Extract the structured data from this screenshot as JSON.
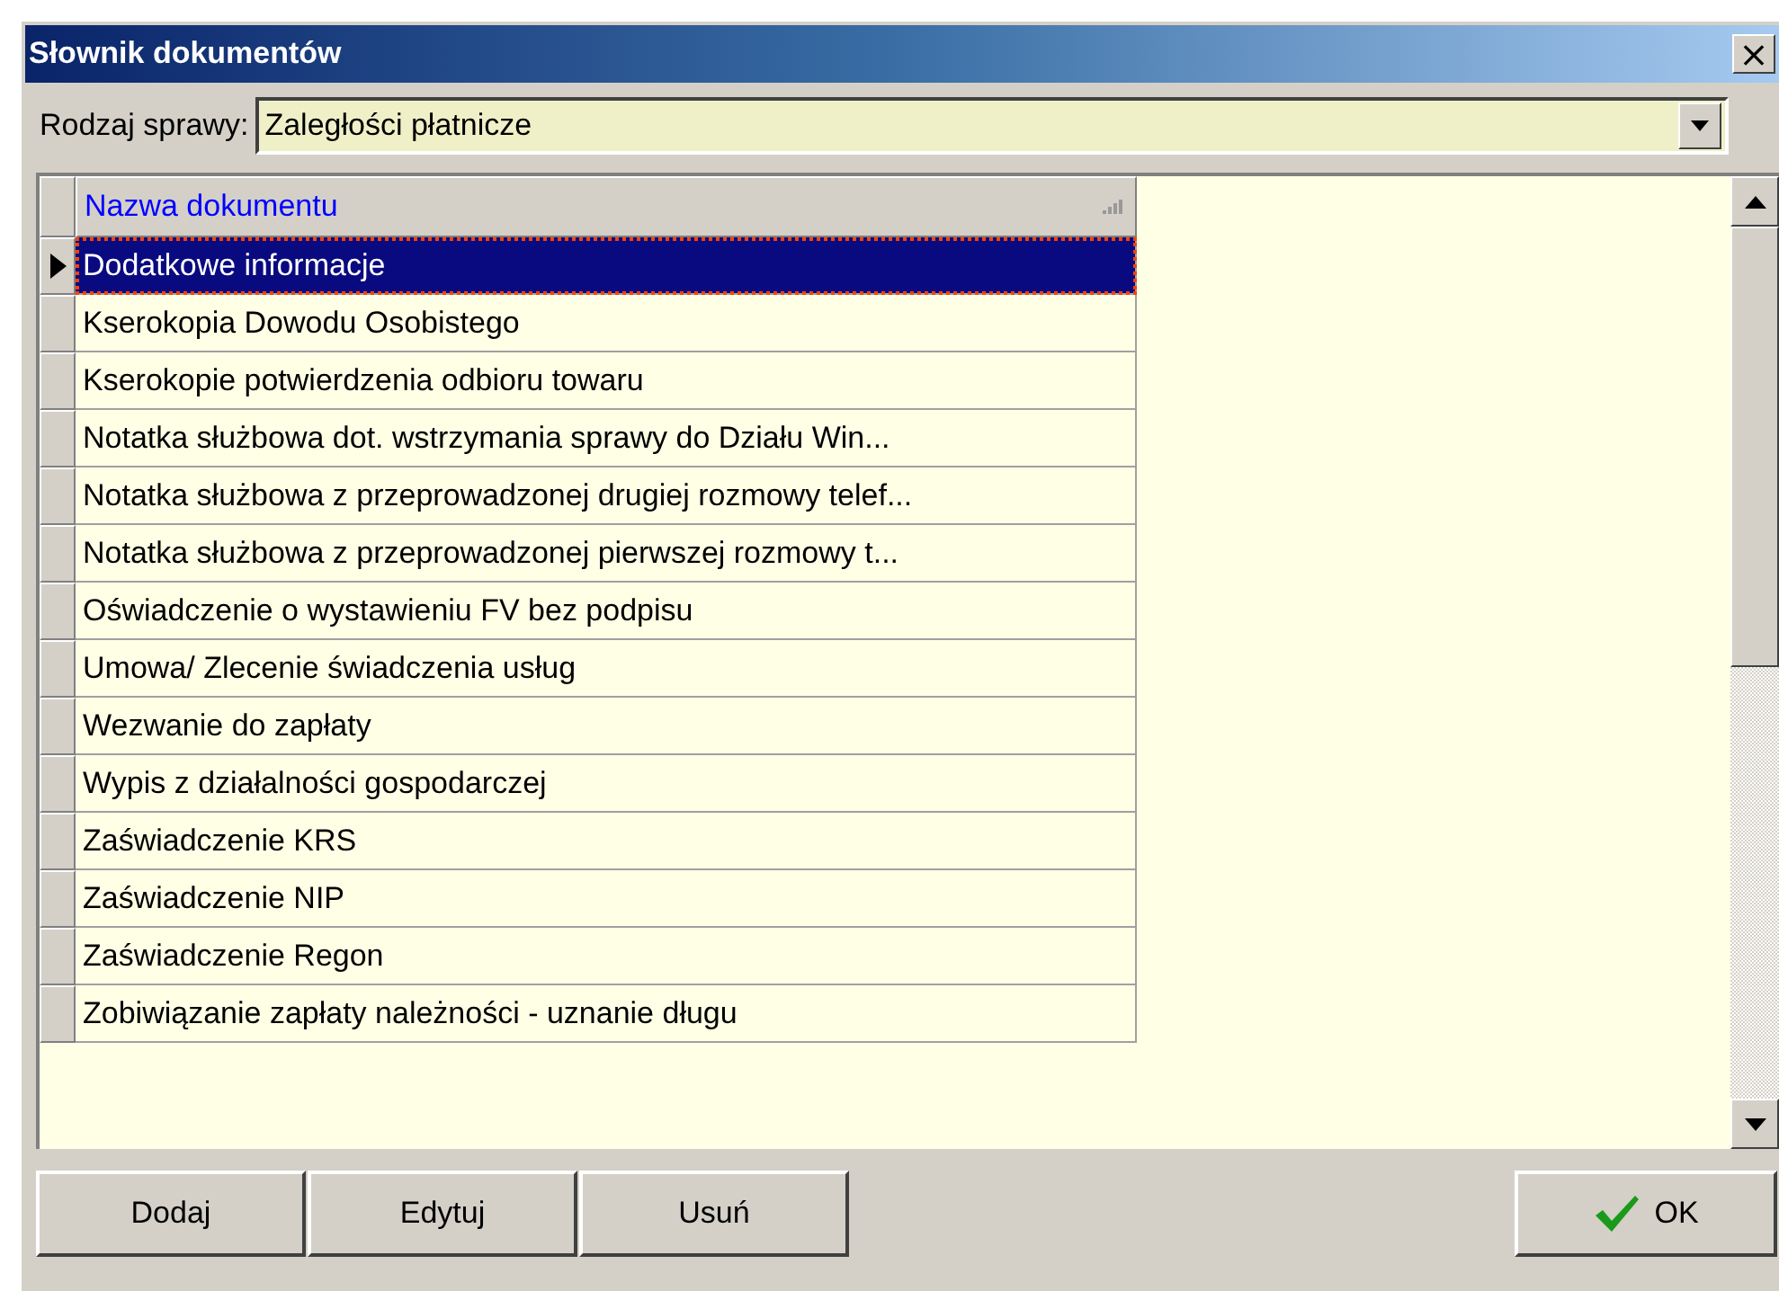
{
  "window": {
    "title": "Słownik dokumentów",
    "close": "×"
  },
  "filter": {
    "label": "Rodzaj sprawy:",
    "value": "Zaległości płatnicze"
  },
  "table": {
    "columns": [
      "Nazwa dokumentu"
    ],
    "rows": [
      {
        "name": "Dodatkowe informacje",
        "selected": true
      },
      {
        "name": "Kserokopia Dowodu Osobistego",
        "selected": false
      },
      {
        "name": "Kserokopie potwierdzenia odbioru towaru",
        "selected": false
      },
      {
        "name": "Notatka służbowa dot. wstrzymania sprawy do Działu Win...",
        "selected": false
      },
      {
        "name": "Notatka służbowa z przeprowadzonej drugiej rozmowy telef...",
        "selected": false
      },
      {
        "name": "Notatka służbowa z przeprowadzonej pierwszej rozmowy t...",
        "selected": false
      },
      {
        "name": "Oświadczenie o wystawieniu FV bez podpisu",
        "selected": false
      },
      {
        "name": "Umowa/ Zlecenie świadczenia usług",
        "selected": false
      },
      {
        "name": "Wezwanie do zapłaty",
        "selected": false
      },
      {
        "name": "Wypis z działalności gospodarczej",
        "selected": false
      },
      {
        "name": "Zaświadczenie KRS",
        "selected": false
      },
      {
        "name": "Zaświadczenie NIP",
        "selected": false
      },
      {
        "name": "Zaświadczenie Regon",
        "selected": false
      },
      {
        "name": "Zobiwiązanie zapłaty należności - uznanie długu",
        "selected": false
      }
    ]
  },
  "buttons": [
    {
      "label": "Dodaj",
      "kind": "plain"
    },
    {
      "label": "Edytuj",
      "kind": "plain"
    },
    {
      "label": "Usuń",
      "kind": "plain"
    },
    {
      "label": "OK",
      "kind": "ok"
    }
  ]
}
